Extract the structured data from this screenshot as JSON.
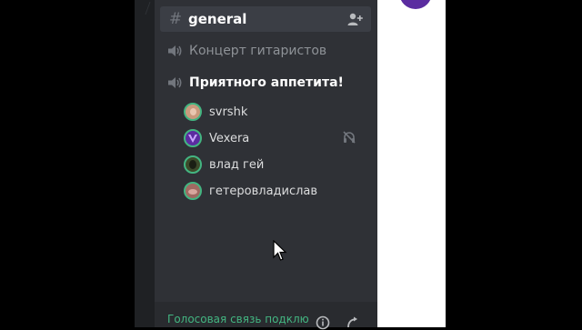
{
  "text_channel": {
    "prefix": "#",
    "name": "general",
    "icon": "add-member-icon"
  },
  "voice_channels": [
    {
      "name": "Концерт гитаристов",
      "icon": "speaker-icon",
      "state": "idle"
    },
    {
      "name": "Приятного аппетита!",
      "icon": "speaker-icon",
      "state": "connected"
    }
  ],
  "voice_users": [
    {
      "name": "svrshk",
      "avatar_color": "#c99a7d"
    },
    {
      "name": "Vexera",
      "avatar_color": "#5b2ca0",
      "status_icon": "deafened-icon"
    },
    {
      "name": "влад гей",
      "avatar_color": "#3c4a2a"
    },
    {
      "name": "гетеровладислав",
      "avatar_color": "#a06a62"
    }
  ],
  "voice_status": {
    "text": "Голосовая связь подклю",
    "color": "#43b581"
  },
  "colors": {
    "accent_green": "#43b581",
    "panel_bg": "#2f3136",
    "active_bg": "#3b3e45",
    "muted_text": "#8e9297",
    "brand_purple": "#5b2ca0"
  }
}
